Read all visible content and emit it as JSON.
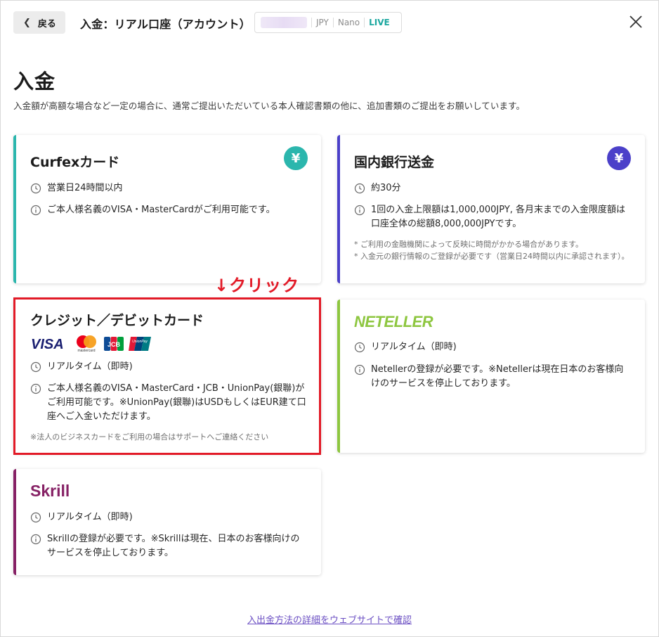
{
  "header": {
    "back_label": "戻る",
    "title": "入金：リアル口座（アカウント）",
    "account": {
      "currency": "JPY",
      "type": "Nano",
      "mode": "LIVE"
    }
  },
  "page": {
    "heading": "入金",
    "subtitle": "入金額が高額な場合など一定の場合に、通常ご提出いただいている本人確認書類の他に、追加書類のご提出をお願いしています。"
  },
  "cards": {
    "curfex": {
      "title": "Curfexカード",
      "accent": "#2bb6ad",
      "badge": "¥",
      "time": "営業日24時間以内",
      "info": "ご本人様名義のVISA・MasterCardがご利用可能です。"
    },
    "bank": {
      "title": "国内銀行送金",
      "accent": "#4b40c9",
      "badge": "¥",
      "time": "約30分",
      "info": "1回の入金上限額は1,000,000JPY, 各月末までの入金限度額は口座全体の総額8,000,000JPYです。",
      "note1": "* ご利用の金融機関によって反映に時間がかかる場合があります。",
      "note2": "* 入金元の銀行情報のご登録が必要です（営業日24時間以内に承認されます）。"
    },
    "credit": {
      "title": "クレジット／デビットカード",
      "accent": "#2bb6ad",
      "logos": {
        "visa": "VISA",
        "mastercard": "mastercard",
        "jcb": "JCB",
        "unionpay": "UnionPay"
      },
      "time": "リアルタイム（即時)",
      "info": "ご本人様名義のVISA・MasterCard・JCB・UnionPay(銀聯)がご利用可能です。※UnionPay(銀聯)はUSDもしくはEUR建て口座へご入金いただけます。",
      "note": "※法人のビジネスカードをご利用の場合はサポートへご連絡ください"
    },
    "neteller": {
      "logo": "NETELLER",
      "accent": "#8dc63f",
      "time": "リアルタイム（即時)",
      "info": "Netellerの登録が必要です。※Netellerは現在日本のお客様向けのサービスを停止しております。"
    },
    "skrill": {
      "logo": "Skrill",
      "accent": "#862165",
      "time": "リアルタイム（即時)",
      "info": "Skrillの登録が必要です。※Skrillは現在、日本のお客様向けのサービスを停止しております。"
    }
  },
  "annotation": {
    "click_label": "↓クリック",
    "color": "#e21a27"
  },
  "footer": {
    "link": "入出金方法の詳細をウェブサイトで確認"
  },
  "icons": {
    "time": "clock-icon",
    "info": "info-icon",
    "close": "close-icon",
    "back": "chevron-left-icon"
  }
}
